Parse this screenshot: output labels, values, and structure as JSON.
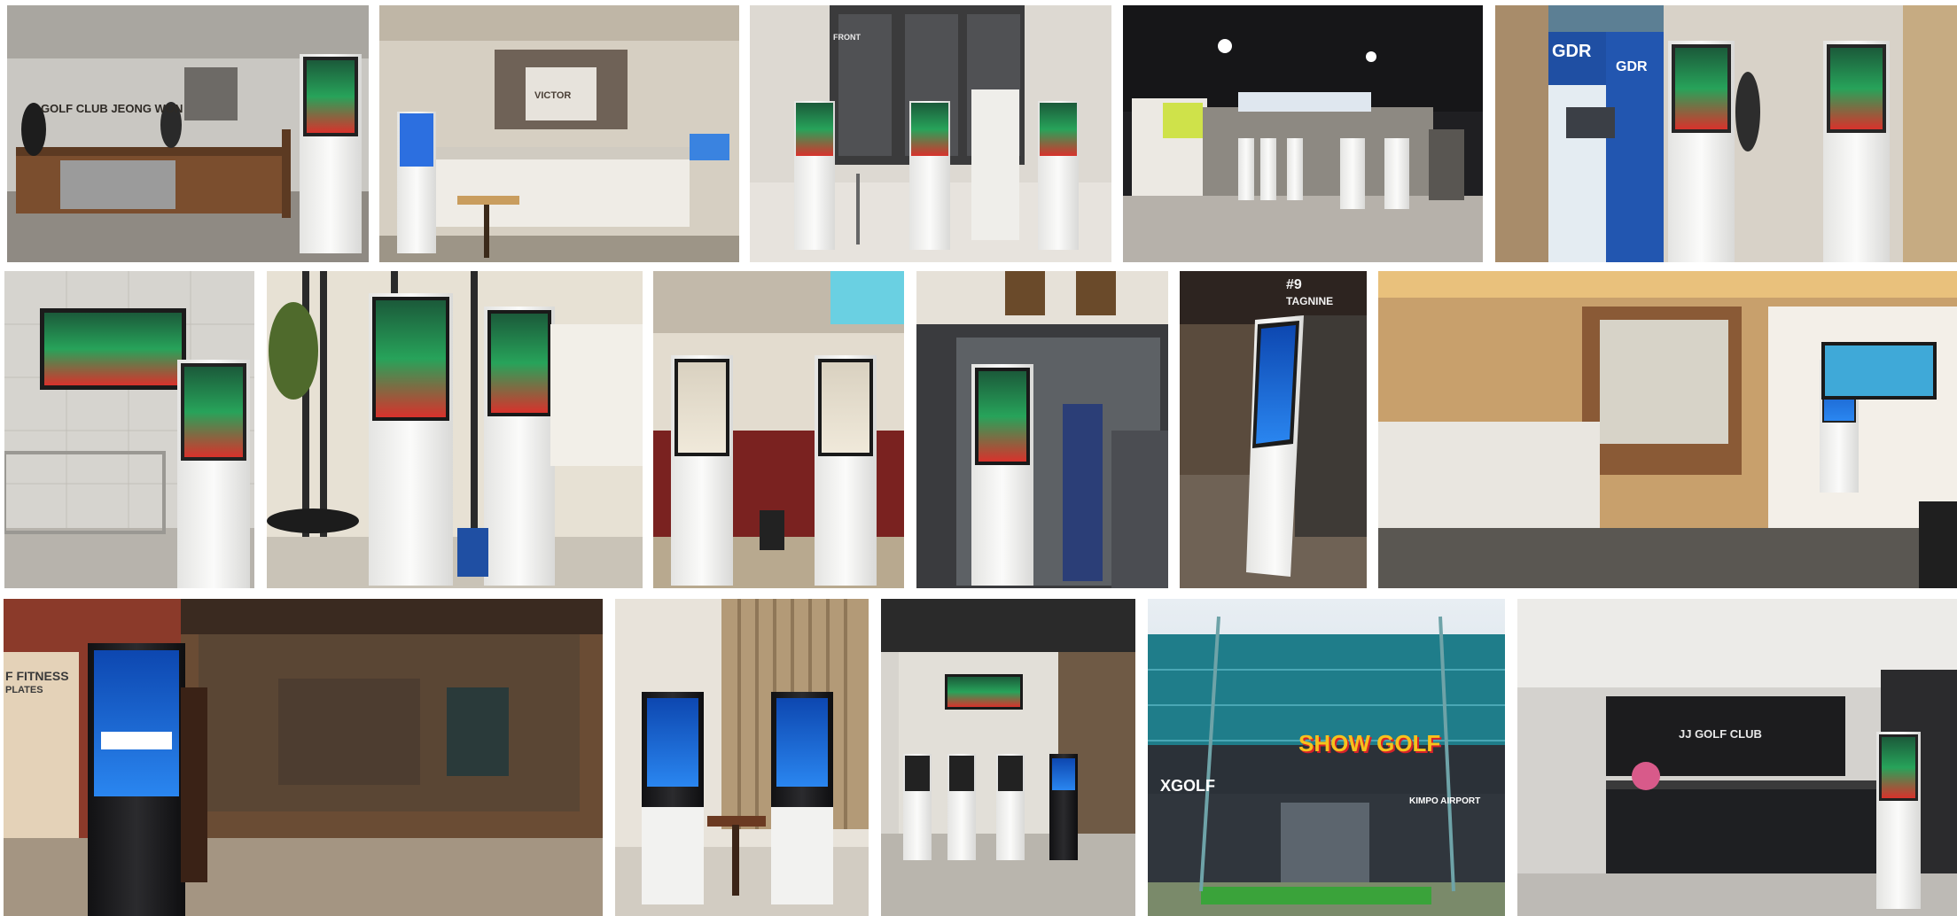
{
  "collage": {
    "photos": [
      {
        "id": "golf-club-jeong-won-lobby",
        "sign_text": "GOLF CLUB JEONG WON"
      },
      {
        "id": "victor-lobby-kiosk",
        "sign_text": "VICTOR"
      },
      {
        "id": "three-kiosks-lobby",
        "sign_text": "FRONT"
      },
      {
        "id": "dark-hall-kiosk-row",
        "sign_text": ""
      },
      {
        "id": "gdr-banner-kiosks",
        "sign_text": "GDR",
        "sign_text_2": "GDR"
      },
      {
        "id": "kiosk-tiled-wall-screen",
        "sign_text": ""
      },
      {
        "id": "two-kiosks-cafe",
        "sign_text": ""
      },
      {
        "id": "two-kiosks-counter",
        "sign_text": ""
      },
      {
        "id": "kiosk-glass-door",
        "sign_text": ""
      },
      {
        "id": "slanted-kiosk-tagnine",
        "sign_text": "#9",
        "sign_text_2": "TAGNINE"
      },
      {
        "id": "reception-counter-kiosk",
        "sign_text": ""
      },
      {
        "id": "fitness-shop-kiosk",
        "sign_text": "F FITNESS",
        "sign_text_2": "PLATES"
      },
      {
        "id": "twin-blue-kiosks-wood-wall",
        "sign_text": ""
      },
      {
        "id": "four-kiosks-corridor",
        "sign_text": ""
      },
      {
        "id": "show-golf-building",
        "sign_text": "SHOW GOLF",
        "sign_text_2": "XGOLF",
        "sign_text_3": "KIMPO AIRPORT"
      },
      {
        "id": "jj-golf-club-reception",
        "sign_text": "JJ GOLF CLUB"
      }
    ],
    "colors": {
      "kiosk_white": "#f2f2f0",
      "kiosk_black": "#1b1b1d",
      "screen_blue": "#1565d6",
      "accent_red": "#d5222a",
      "wood": "#8a5a36",
      "show_golf_yellow": "#f6c21c"
    }
  }
}
